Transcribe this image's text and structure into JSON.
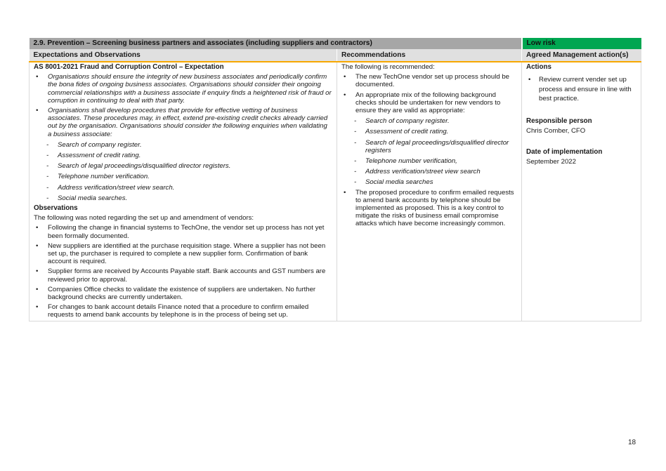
{
  "table": {
    "title": "2.9. Prevention – Screening business partners and associates (including suppliers and contractors)",
    "risk_badge": "Low risk",
    "colors": {
      "title_bg": "#a6a6a6",
      "risk_bg": "#00a651",
      "header_bg": "#e0e0e0",
      "accent_rule": "#f7a800"
    },
    "headers": {
      "expectations": "Expectations and Observations",
      "recommendations": "Recommendations",
      "management": "Agreed Management action(s)"
    },
    "expectations": {
      "heading": "AS 8001-2021 Fraud and Corruption Control – Expectation",
      "bullets": [
        "Organisations should ensure the integrity of new business associates and periodically confirm the bona fides of ongoing business associates. Organisations should consider their ongoing commercial relationships with a business associate if enquiry finds a heightened risk of fraud or corruption in continuing to deal with that party.",
        "Organisations shall develop procedures that provide for effective vetting of business associates. These procedures may, in effect, extend pre-existing credit checks already carried out by the organisation. Organisations should consider the following enquiries when validating a business associate:"
      ],
      "enquiries": [
        "Search of company register.",
        "Assessment of credit rating.",
        "Search of legal proceedings/disqualified director registers.",
        "Telephone number verification.",
        "Address verification/street view search.",
        "Social media searches."
      ]
    },
    "observations": {
      "heading": "Observations",
      "intro": "The following was noted regarding the set up and amendment of vendors:",
      "bullets": [
        "Following the change in financial systems to TechOne, the vendor set up process has not yet been formally documented.",
        "New suppliers are identified at the purchase requisition stage. Where a supplier has not been set up, the purchaser is required to complete a new supplier form. Confirmation of bank account is required.",
        "Supplier forms are received by Accounts Payable staff. Bank accounts and GST numbers are reviewed prior to approval.",
        "Companies Office checks to validate the existence of suppliers are undertaken. No further background checks are currently undertaken.",
        "For changes to bank account details Finance noted that a procedure to confirm emailed requests to amend bank accounts by telephone is in the process of being set up."
      ]
    },
    "recommendations": {
      "intro": "The following is recommended:",
      "bullet_1": "The new TechOne vendor set up process should be documented.",
      "bullet_2": "An appropriate mix of the following background checks should be undertaken for new vendors to ensure they are valid as appropriate:",
      "checks": [
        "Search of company register.",
        "Assessment of credit rating.",
        "Search of legal proceedings/disqualified director registers",
        "Telephone number verification,",
        "Address verification/street view search",
        "Social media searches"
      ],
      "bullet_3": "The proposed procedure to confirm emailed requests to amend bank accounts by telephone should be implemented as proposed. This is a key control to mitigate the risks of business email compromise attacks which have become increasingly common."
    },
    "management": {
      "actions_heading": "Actions",
      "actions": [
        "Review current vender set up process and ensure in line with best practice."
      ],
      "responsible_heading": "Responsible person",
      "responsible_value": "Chris Comber, CFO",
      "date_heading": "Date of implementation",
      "date_value": "September 2022"
    }
  },
  "page_number": "18"
}
